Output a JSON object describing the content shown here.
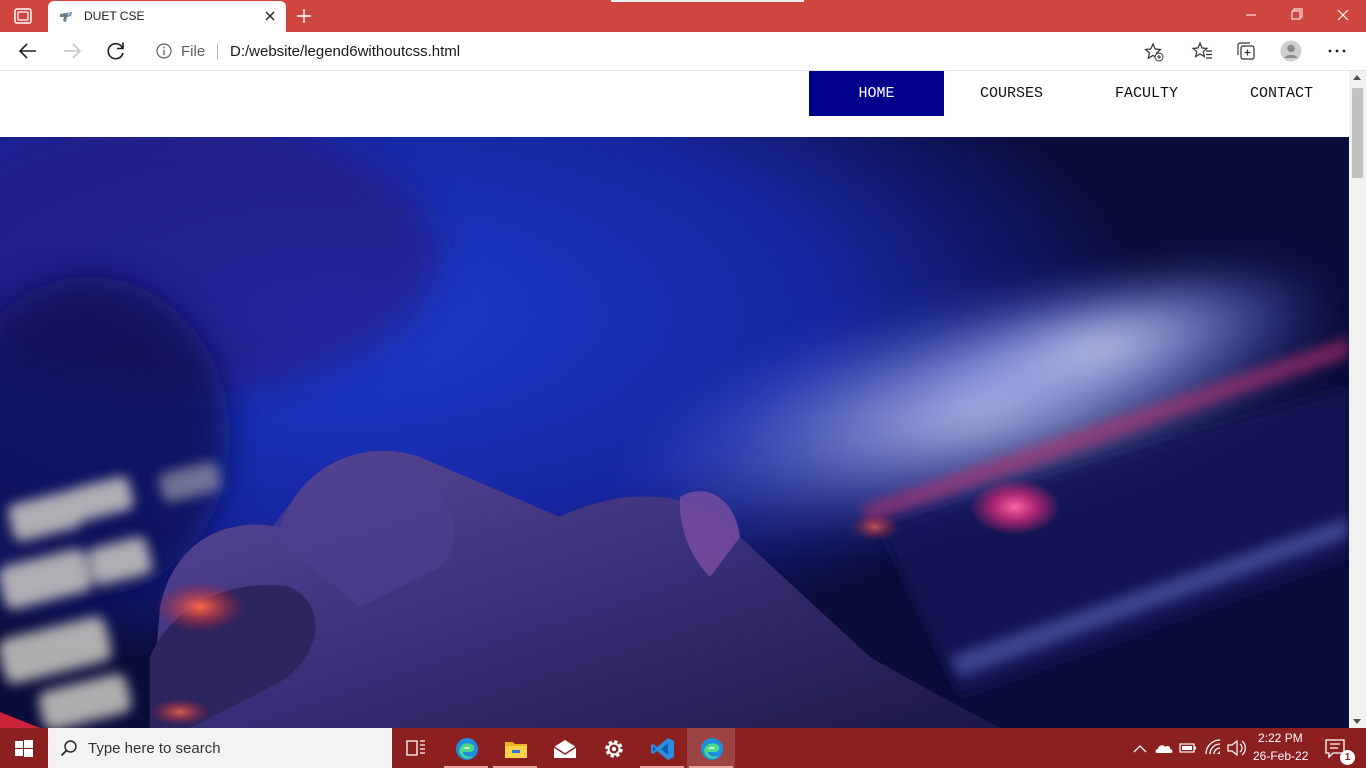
{
  "browser": {
    "tab": {
      "title": "DUET CSE"
    },
    "address": {
      "scheme": "File",
      "url": "D:/website/legend6withoutcss.html"
    }
  },
  "site": {
    "nav": [
      {
        "label": "HOME",
        "active": true
      },
      {
        "label": "COURSES",
        "active": false
      },
      {
        "label": "FACULTY",
        "active": false
      },
      {
        "label": "CONTACT",
        "active": false
      }
    ],
    "hero": {
      "icon": "hand-on-keyboard-photo"
    }
  },
  "taskbar": {
    "search_placeholder": "Type here to search",
    "pinned": [
      "task-view-icon",
      "edge-icon",
      "file-explorer-icon",
      "mail-icon",
      "settings-icon",
      "vscode-icon",
      "edge-icon"
    ],
    "clock": {
      "time": "2:22 PM",
      "date": "26-Feb-22"
    },
    "notifications": "1"
  },
  "colors": {
    "titlebar": "#cf4540",
    "taskbar": "#8c1f1f",
    "nav_active": "#00008b"
  }
}
